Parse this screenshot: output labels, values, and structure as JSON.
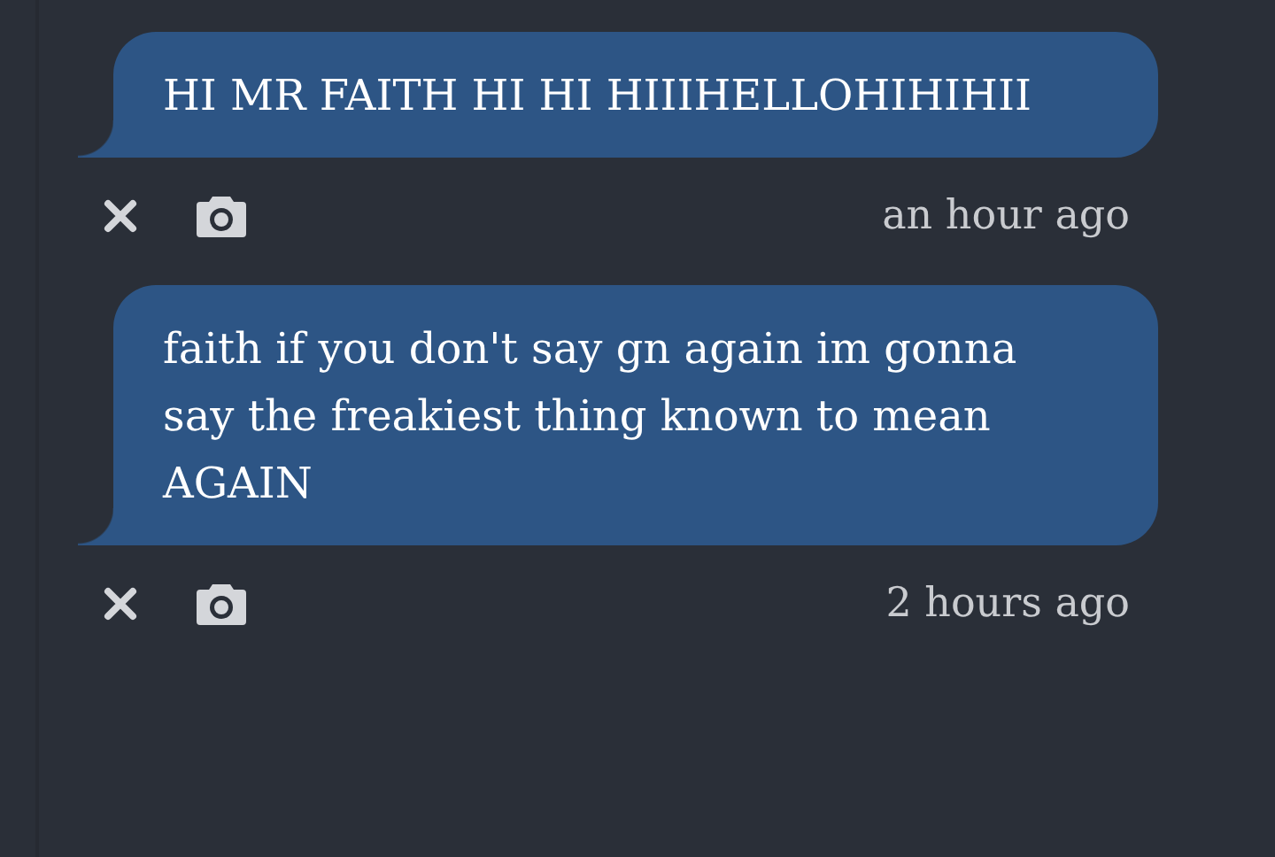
{
  "messages": [
    {
      "text": "HI MR FAITH HI HI HIIIHELLOHIHIHII",
      "time": "an hour ago"
    },
    {
      "text": "faith if you don't say gn again im gonna say the freakiest thing known to mean AGAIN",
      "time": "2 hours ago"
    }
  ]
}
